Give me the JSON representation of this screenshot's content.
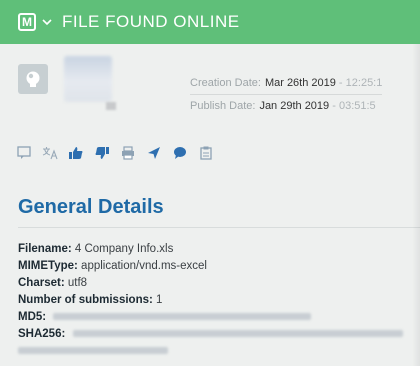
{
  "banner": {
    "badge": "M",
    "title": "FILE FOUND ONLINE",
    "color": "#5fbf79"
  },
  "file": {
    "creation_label": "Creation Date:",
    "creation_date": "Mar 26th 2019",
    "creation_time": "12:25:1",
    "publish_label": "Publish Date:",
    "publish_date": "Jan 29th 2019",
    "publish_time": "03:51:5"
  },
  "toolbar": {
    "icons": [
      "comment-add-icon",
      "translate-icon",
      "thumbs-up-icon",
      "thumbs-down-icon",
      "print-icon",
      "send-icon",
      "chat-icon",
      "clipboard-icon"
    ]
  },
  "section": {
    "title": "General Details",
    "accent": "#1f6aa6"
  },
  "details": {
    "filename_label": "Filename:",
    "filename": "4 Company Info.xls",
    "mime_label": "MIMEType:",
    "mime": "application/vnd.ms-excel",
    "charset_label": "Charset:",
    "charset": "utf8",
    "submissions_label": "Number of submissions:",
    "submissions": "1",
    "md5_label": "MD5:",
    "sha256_label": "SHA256:"
  }
}
